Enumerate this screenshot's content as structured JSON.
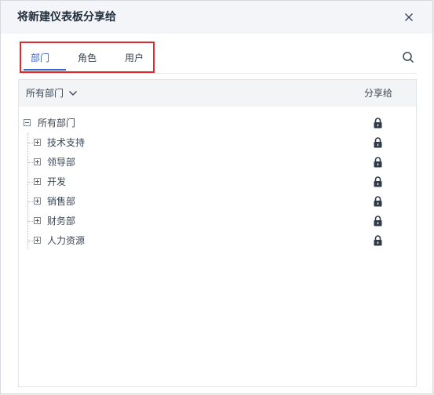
{
  "dialog": {
    "title": "将新建仪表板分享给",
    "close_icon": "close-icon"
  },
  "tabs": [
    {
      "label": "部门",
      "active": true
    },
    {
      "label": "角色",
      "active": false
    },
    {
      "label": "用户",
      "active": false
    }
  ],
  "search_icon": "search-icon",
  "table": {
    "filter_label": "所有部门",
    "share_column": "分享给"
  },
  "tree": {
    "root": {
      "label": "所有部门",
      "expanded": true,
      "lock_icon": "lock-icon"
    },
    "children": [
      {
        "label": "技术支持",
        "expanded": false
      },
      {
        "label": "领导部",
        "expanded": false
      },
      {
        "label": "开发",
        "expanded": false
      },
      {
        "label": "销售部",
        "expanded": false
      },
      {
        "label": "财务部",
        "expanded": false
      },
      {
        "label": "人力资源",
        "expanded": false
      }
    ]
  },
  "colors": {
    "accent": "#3d66ce",
    "highlight_box": "#e0272b",
    "lock": "#2f3a48"
  }
}
